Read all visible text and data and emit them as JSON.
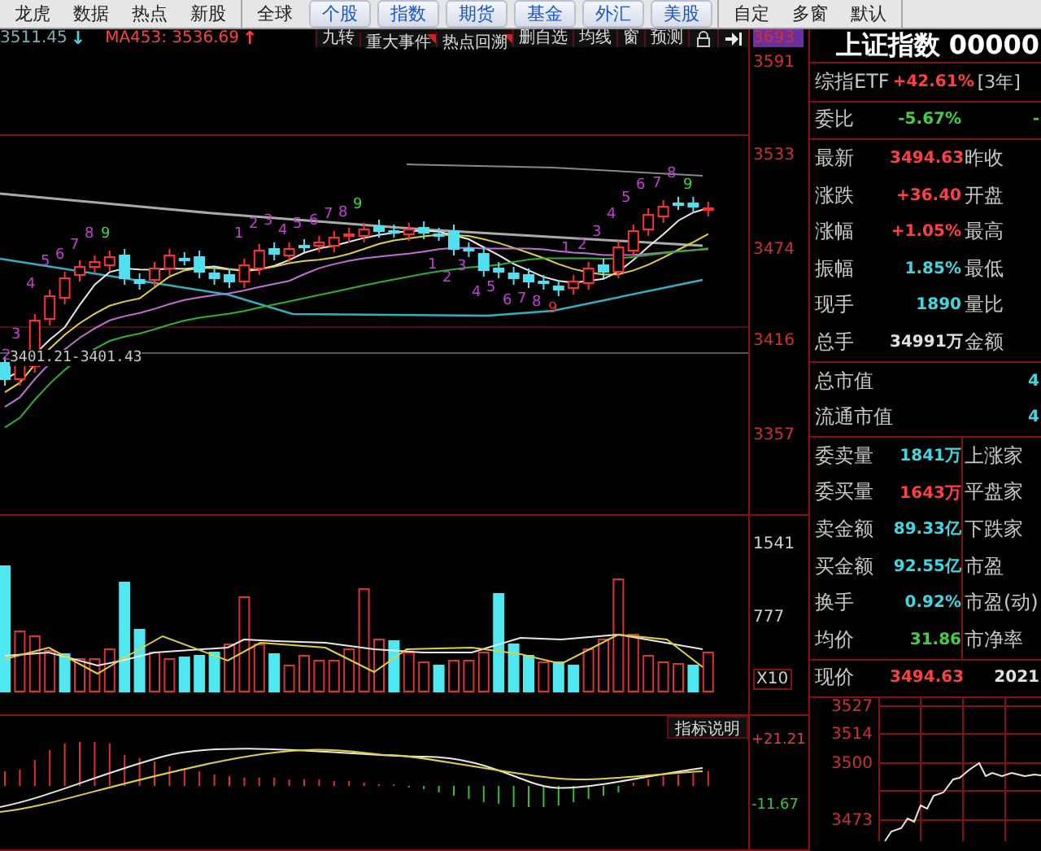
{
  "toolbar": [
    {
      "kind": "plain",
      "buttons": [
        "龙虎",
        "数据",
        "热点",
        "新股"
      ]
    },
    {
      "kind": "market",
      "buttons": [
        "全球",
        "个股",
        "指数",
        "期货",
        "基金",
        "外汇",
        "美股"
      ]
    },
    {
      "kind": "plain",
      "buttons": [
        "自定",
        "多窗",
        "默认"
      ]
    }
  ],
  "quote_line": {
    "price": "3511.45",
    "price_arrow": "↓",
    "ma_label": "MA453: 3536.69",
    "ma_arrow": "↑"
  },
  "chart_tools": [
    {
      "label": "九转",
      "flagged": false
    },
    {
      "label": "重大事件",
      "flagged": true
    },
    {
      "label": "热点回溯",
      "flagged": true
    },
    {
      "label": "删自选",
      "flagged": false
    },
    {
      "label": "均线",
      "flagged": false
    },
    {
      "label": "窗",
      "flagged": false
    },
    {
      "label": "预测",
      "flagged": false
    }
  ],
  "price_axis": [
    {
      "text": "3693",
      "highlighted": true
    },
    {
      "text": "3591",
      "highlighted": false
    },
    {
      "text": "3533",
      "highlighted": false
    },
    {
      "text": "3474",
      "highlighted": false
    },
    {
      "text": "3416",
      "highlighted": false
    },
    {
      "text": "3357",
      "highlighted": false
    }
  ],
  "range_label": "3401.21-3401.43",
  "sequence_marks": [
    {
      "text": "2",
      "color": "#c040d0"
    },
    {
      "text": "3",
      "color": "#c040d0"
    },
    {
      "text": "4",
      "color": "#c040d0"
    },
    {
      "text": "5",
      "color": "#c040d0"
    },
    {
      "text": "6",
      "color": "#c040d0"
    },
    {
      "text": "7",
      "color": "#c040d0"
    },
    {
      "text": "8",
      "color": "#c040d0"
    },
    {
      "text": "9",
      "color": "#40d040"
    },
    {
      "text": "1",
      "color": "#c040d0"
    },
    {
      "text": "2",
      "color": "#c040d0"
    },
    {
      "text": "3",
      "color": "#c040d0"
    },
    {
      "text": "4",
      "color": "#c040d0"
    },
    {
      "text": "5",
      "color": "#c040d0"
    },
    {
      "text": "6",
      "color": "#c040d0"
    },
    {
      "text": "7",
      "color": "#c040d0"
    },
    {
      "text": "8",
      "color": "#c040d0"
    },
    {
      "text": "9",
      "color": "#40d040"
    },
    {
      "text": "1",
      "color": "#c040d0"
    },
    {
      "text": "2",
      "color": "#c040d0"
    },
    {
      "text": "3",
      "color": "#c040d0"
    },
    {
      "text": "4",
      "color": "#c040d0"
    },
    {
      "text": "5",
      "color": "#c040d0"
    },
    {
      "text": "6",
      "color": "#c040d0"
    },
    {
      "text": "7",
      "color": "#c040d0"
    },
    {
      "text": "8",
      "color": "#c040d0"
    },
    {
      "text": "9",
      "color": "#e03030"
    },
    {
      "text": "1",
      "color": "#c040d0"
    },
    {
      "text": "2",
      "color": "#c040d0"
    },
    {
      "text": "3",
      "color": "#c040d0"
    },
    {
      "text": "4",
      "color": "#c040d0"
    },
    {
      "text": "5",
      "color": "#c040d0"
    },
    {
      "text": "6",
      "color": "#c040d0"
    },
    {
      "text": "7",
      "color": "#c040d0"
    },
    {
      "text": "8",
      "color": "#c040d0"
    },
    {
      "text": "9",
      "color": "#40d040"
    }
  ],
  "volume_axis": [
    "1541",
    "777",
    "X10"
  ],
  "indicator_button": "指标说明",
  "macd_axis": [
    {
      "text": "+21.21",
      "color": "#e04040"
    },
    {
      "text": "-11.67",
      "color": "#40c040"
    }
  ],
  "quote_panel": {
    "title": "上证指数 00000",
    "etf": {
      "label": "综指ETF",
      "value": "+42.61%",
      "suffix": "[3年]"
    },
    "sections": [
      {
        "divided": false,
        "rows": [
          {
            "label": "委比",
            "value": "-5.67%",
            "color": "#40d040",
            "edge": "-"
          }
        ]
      },
      {
        "divided": false,
        "rows": [
          {
            "label": "最新",
            "value": "3494.63",
            "color": "#ff4040",
            "label2": "昨收"
          },
          {
            "label": "涨跌",
            "value": "+36.40",
            "color": "#ff4040",
            "label2": "开盘"
          },
          {
            "label": "涨幅",
            "value": "+1.05%",
            "color": "#ff4040",
            "label2": "最高"
          },
          {
            "label": "振幅",
            "value": "1.85%",
            "color": "#40d8e0",
            "label2": "最低"
          },
          {
            "label": "现手",
            "value": "1890",
            "color": "#40d8e0",
            "label2": "量比"
          },
          {
            "label": "总手",
            "value": "34991万",
            "color": "#e0e0e0",
            "label2": "金额"
          }
        ]
      },
      {
        "divided": false,
        "rows": [
          {
            "label": "总市值",
            "color": "#40d8e0",
            "edge": "4"
          },
          {
            "label": "流通市值",
            "color": "#40d8e0",
            "edge": "4"
          }
        ]
      },
      {
        "divided": true,
        "rows": [
          {
            "label": "委卖量",
            "value": "1841万",
            "color": "#40d8e0",
            "label2": "上涨家"
          },
          {
            "label": "委买量",
            "value": "1643万",
            "color": "#ff4040",
            "label2": "平盘家"
          },
          {
            "label": "卖金额",
            "value": "89.33亿",
            "color": "#40d8e0",
            "label2": "下跌家"
          },
          {
            "label": "买金额",
            "value": "92.55亿",
            "color": "#40d8e0",
            "label2": "市盈"
          },
          {
            "label": "换手",
            "value": "0.92%",
            "color": "#40d8e0",
            "label2": "市盈(动)"
          },
          {
            "label": "均价",
            "value": "31.86",
            "color": "#40d040",
            "label2": "市净率"
          }
        ]
      },
      {
        "divided": false,
        "rows": [
          {
            "label": "现价",
            "value": "3494.63",
            "color": "#ff4040",
            "edge": "2021"
          }
        ]
      }
    ],
    "intraday_axis": [
      "3527",
      "3514",
      "3500",
      "3473"
    ]
  }
}
